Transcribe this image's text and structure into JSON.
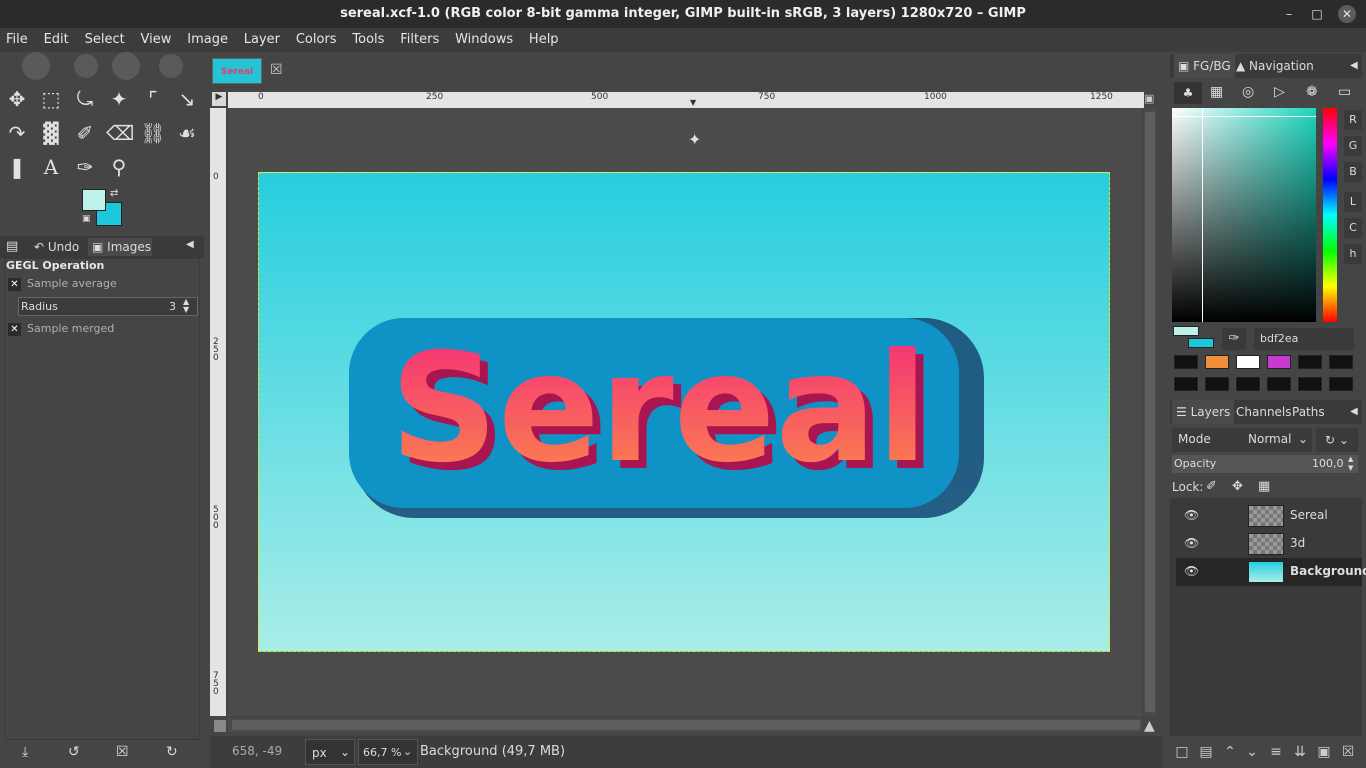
{
  "window": {
    "title": "sereal.xcf-1.0 (RGB color 8-bit gamma integer, GIMP built-in sRGB, 3 layers) 1280x720 – GIMP"
  },
  "menu": [
    "File",
    "Edit",
    "Select",
    "View",
    "Image",
    "Layer",
    "Colors",
    "Tools",
    "Filters",
    "Windows",
    "Help"
  ],
  "left_dock": {
    "tabs": [
      "Undo",
      "Images"
    ],
    "tool_options_title": "GEGL Operation",
    "sample_average_label": "Sample average",
    "radius_label": "Radius",
    "radius_value": "3",
    "sample_merged_label": "Sample merged"
  },
  "image_tab": {
    "thumb_text": "Sereal"
  },
  "ruler": {
    "h_ticks": [
      "0",
      "250",
      "500",
      "750",
      "1000",
      "1250"
    ],
    "v_ticks": [
      "0",
      "250",
      "500",
      "750"
    ]
  },
  "canvas": {
    "art_text": "Sereal"
  },
  "status": {
    "coords": "658, -49",
    "unit": "px",
    "zoom": "66,7 %",
    "layer_info": "Background (49,7 MB)"
  },
  "right_dock": {
    "color_tabs": [
      "FG/BG",
      "Navigation"
    ],
    "channels": [
      "R",
      "G",
      "B",
      "L",
      "C",
      "h"
    ],
    "hex_value": "bdf2ea",
    "layers_tabs": [
      "Layers",
      "Channels",
      "Paths"
    ],
    "mode_label": "Mode",
    "mode_value": "Normal",
    "opacity_label": "Opacity",
    "opacity_value": "100,0",
    "lock_label": "Lock:",
    "layers": [
      {
        "name": "Sereal"
      },
      {
        "name": "3d"
      },
      {
        "name": "Background"
      }
    ]
  },
  "colors": {
    "fg": "#bdf2ea",
    "bg": "#1ec8dc",
    "swatches": [
      "#111111",
      "#f0903a",
      "#ffffff",
      "#c83ad0",
      "#111111",
      "#111111",
      "#111111",
      "#111111",
      "#111111",
      "#111111",
      "#111111",
      "#111111"
    ]
  }
}
